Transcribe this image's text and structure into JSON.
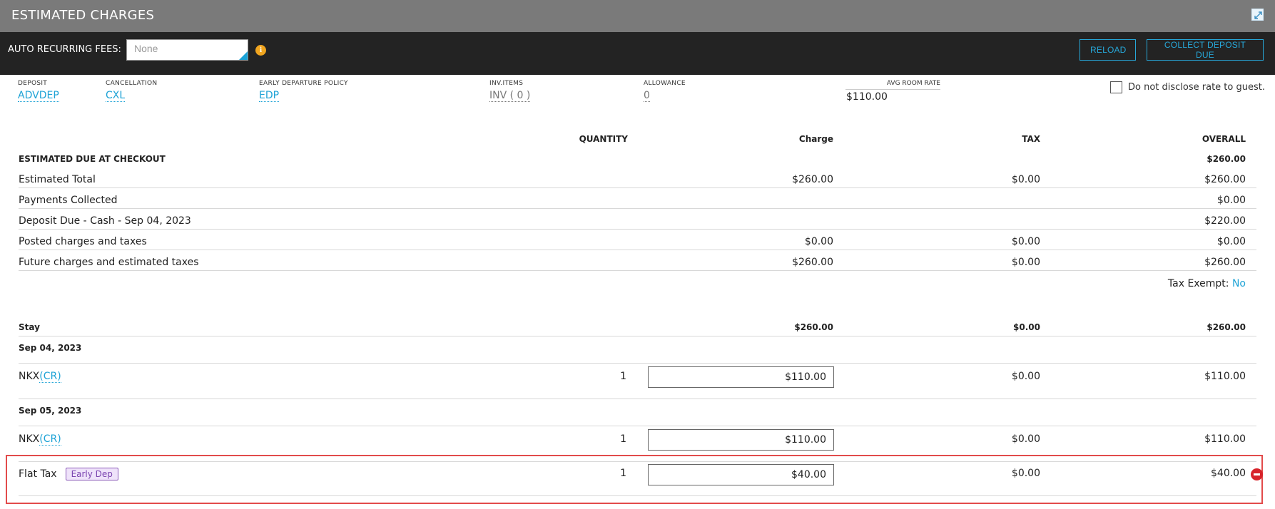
{
  "window": {
    "title": "ESTIMATED CHARGES"
  },
  "toolbar": {
    "auto_recurring_label": "AUTO RECURRING FEES:",
    "auto_recurring_placeholder": "None",
    "reload_label": "RELOAD",
    "collect_label": "COLLECT DEPOSIT DUE"
  },
  "policies": {
    "deposit": {
      "label": "DEPOSIT",
      "value": "ADVDEP"
    },
    "cancellation": {
      "label": "CANCELLATION",
      "value": "CXL"
    },
    "early_departure": {
      "label": "EARLY DEPARTURE POLICY",
      "value": "EDP"
    },
    "inv_items": {
      "label": "INV.ITEMS",
      "value": "INV ( 0 )"
    },
    "allowance": {
      "label": "ALLOWANCE",
      "value": "0"
    },
    "avg_room_rate": {
      "label": "AVG ROOM RATE",
      "value": "$110.00"
    }
  },
  "no_disclose_label": "Do not disclose rate to guest.",
  "columns": {
    "quantity": "QUANTITY",
    "charge": "Charge",
    "tax": "TAX",
    "overall": "OVERALL"
  },
  "summary": {
    "heading": "ESTIMATED DUE AT CHECKOUT",
    "heading_overall": "$260.00",
    "rows": [
      {
        "label": "Estimated Total",
        "charge": "$260.00",
        "tax": "$0.00",
        "overall": "$260.00"
      },
      {
        "label": "Payments Collected",
        "charge": "",
        "tax": "",
        "overall": "$0.00"
      },
      {
        "label": "Deposit Due - Cash - Sep 04, 2023",
        "charge": "",
        "tax": "",
        "overall": "$220.00"
      },
      {
        "label": "Posted charges and taxes",
        "charge": "$0.00",
        "tax": "$0.00",
        "overall": "$0.00"
      },
      {
        "label": "Future charges and estimated taxes",
        "charge": "$260.00",
        "tax": "$0.00",
        "overall": "$260.00"
      }
    ],
    "tax_exempt_label": "Tax Exempt:",
    "tax_exempt_value": "No"
  },
  "stay": {
    "label": "Stay",
    "charge": "$260.00",
    "tax": "$0.00",
    "overall": "$260.00",
    "day1": {
      "date": "Sep 04, 2023",
      "item": "NKX",
      "item_link": "(CR)",
      "quantity": "1",
      "charge": "$110.00",
      "tax": "$0.00",
      "overall": "$110.00"
    },
    "day2": {
      "date": "Sep 05, 2023",
      "item": "NKX",
      "item_link": "(CR)",
      "quantity": "1",
      "charge": "$110.00",
      "tax": "$0.00",
      "overall": "$110.00"
    },
    "flat_tax": {
      "label": "Flat Tax",
      "tag": "Early Dep",
      "quantity": "1",
      "charge": "$40.00",
      "tax": "$0.00",
      "overall": "$40.00"
    }
  }
}
